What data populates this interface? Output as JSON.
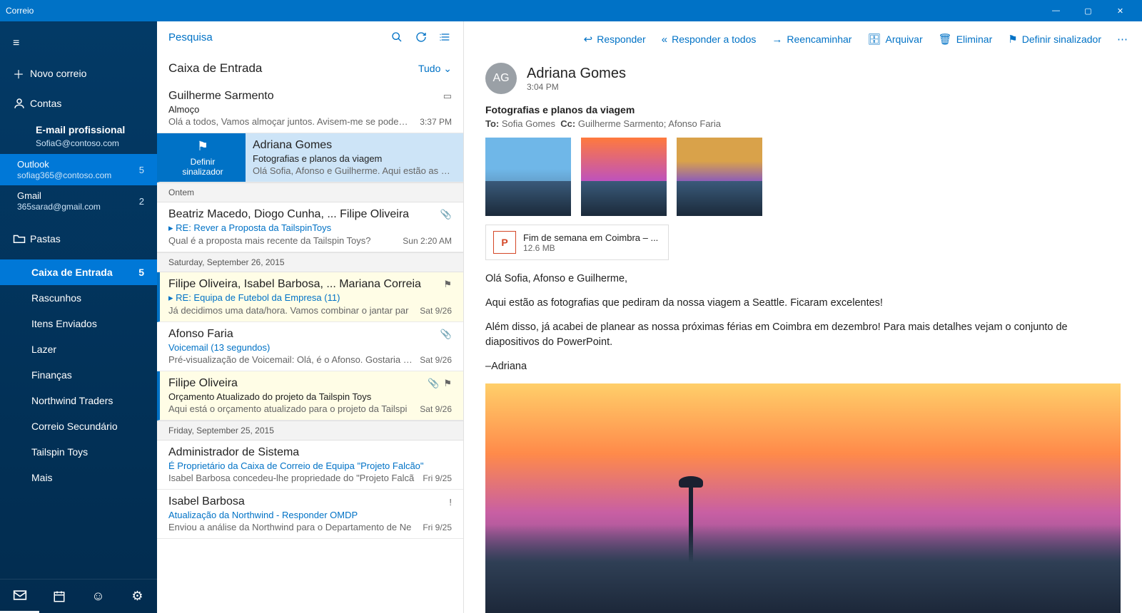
{
  "titlebar": {
    "title": "Correio"
  },
  "sidebar": {
    "hamburger": "≡",
    "newmail": "Novo correio",
    "accounts_label": "Contas",
    "profile": {
      "title": "E-mail profissional",
      "email": "SofiaG@contoso.com"
    },
    "accounts": [
      {
        "name": "Outlook",
        "email": "sofiag365@contoso.com",
        "badge": "5",
        "active": true
      },
      {
        "name": "Gmail",
        "email": "365sarad@gmail.com",
        "badge": "2",
        "active": false
      }
    ],
    "folders_label": "Pastas",
    "folders": [
      {
        "label": "Caixa de Entrada",
        "badge": "5",
        "active": true
      },
      {
        "label": "Rascunhos"
      },
      {
        "label": "Itens Enviados"
      },
      {
        "label": "Lazer"
      },
      {
        "label": "Finanças"
      },
      {
        "label": "Northwind Traders"
      },
      {
        "label": "Correio Secundário"
      },
      {
        "label": "Tailspin Toys"
      },
      {
        "label": "Mais"
      }
    ]
  },
  "msglist": {
    "search_placeholder": "Pesquisa",
    "folder_title": "Caixa de Entrada",
    "filter": "Tudo",
    "groups": [
      {
        "header": "",
        "messages": [
          {
            "from": "Guilherme Sarmento",
            "subject": "Almoço",
            "subject_plain": true,
            "preview": "Olá a todos, Vamos almoçar juntos. Avisem-me se podem a",
            "time": "3:37 PM",
            "event_icon": true
          }
        ]
      },
      {
        "header": "",
        "selected": true,
        "messages": [
          {
            "from": "Adriana Gomes",
            "subject": "Fotografias e planos da viagem",
            "preview": "Olá Sofia, Afonso e Guilherme. Aqui estão as fotog",
            "flag_label_1": "Definir",
            "flag_label_2": "sinalizador"
          }
        ]
      },
      {
        "header": "Ontem",
        "messages": [
          {
            "from": "Beatriz Macedo, Diogo Cunha, ... Filipe Oliveira",
            "subject": "▸ RE: Rever a Proposta da TailspinToys",
            "preview": "Qual é a proposta mais recente da Tailspin Toys?",
            "time": "Sun 2:20 AM",
            "attach_icon": true
          }
        ]
      },
      {
        "header": "Saturday, September 26, 2015",
        "messages": [
          {
            "from": "Filipe Oliveira, Isabel Barbosa, ... Mariana Correia",
            "subject": "▸ RE: Equipa de Futebol da Empresa (11)",
            "preview": "Já decidimos uma data/hora. Vamos combinar o jantar par",
            "time": "Sat 9/26",
            "flag_icon": true,
            "unread": true,
            "yellow": true
          },
          {
            "from": "Afonso Faria",
            "subject": "Voicemail (13 segundos)",
            "preview": "Pré-visualização de Voicemail: Olá, é o Afonso. Gostaria de",
            "time": "Sat 9/26",
            "attach_icon": true
          },
          {
            "from": "Filipe Oliveira",
            "subject": "Orçamento Atualizado do projeto da Tailspin Toys",
            "subject_plain": true,
            "preview": "Aqui está o orçamento atualizado para o projeto da Tailspi",
            "time": "Sat 9/26",
            "attach_icon": true,
            "flag_icon": true,
            "unread": true,
            "yellow": true
          }
        ]
      },
      {
        "header": "Friday, September 25, 2015",
        "messages": [
          {
            "from": "Administrador de Sistema",
            "subject": "É Proprietário da Caixa de Correio de Equipa \"Projeto Falcão\"",
            "preview": "Isabel Barbosa concedeu-lhe propriedade do \"Projeto Falcã",
            "time": "Fri 9/25"
          },
          {
            "from": "Isabel Barbosa",
            "subject": "Atualização da Northwind - Responder OMDP",
            "preview": "Enviou a análise da Northwind para o Departamento de Ne",
            "time": "Fri 9/25",
            "important_icon": true
          }
        ]
      }
    ]
  },
  "reading": {
    "actions": {
      "reply": "Responder",
      "reply_all": "Responder a todos",
      "forward": "Reencaminhar",
      "archive": "Arquivar",
      "delete": "Eliminar",
      "flag": "Definir sinalizador"
    },
    "avatar": "AG",
    "sender_name": "Adriana Gomes",
    "sent_time": "3:04 PM",
    "subject": "Fotografias e planos da viagem",
    "to_label": "To:",
    "to_value": "Sofia Gomes",
    "cc_label": "Cc:",
    "cc_value": "Guilherme Sarmento; Afonso Faria",
    "attachment": {
      "name": "Fim de semana em Coimbra – ...",
      "size": "12.6 MB"
    },
    "body": [
      "Olá Sofia, Afonso e Guilherme,",
      "Aqui estão as fotografias que pediram da nossa viagem a Seattle. Ficaram excelentes!",
      "Além disso, já acabei de planear as nossa próximas férias em Coimbra em dezembro! Para mais detalhes vejam o conjunto de diapositivos do PowerPoint.",
      "–Adriana"
    ]
  }
}
